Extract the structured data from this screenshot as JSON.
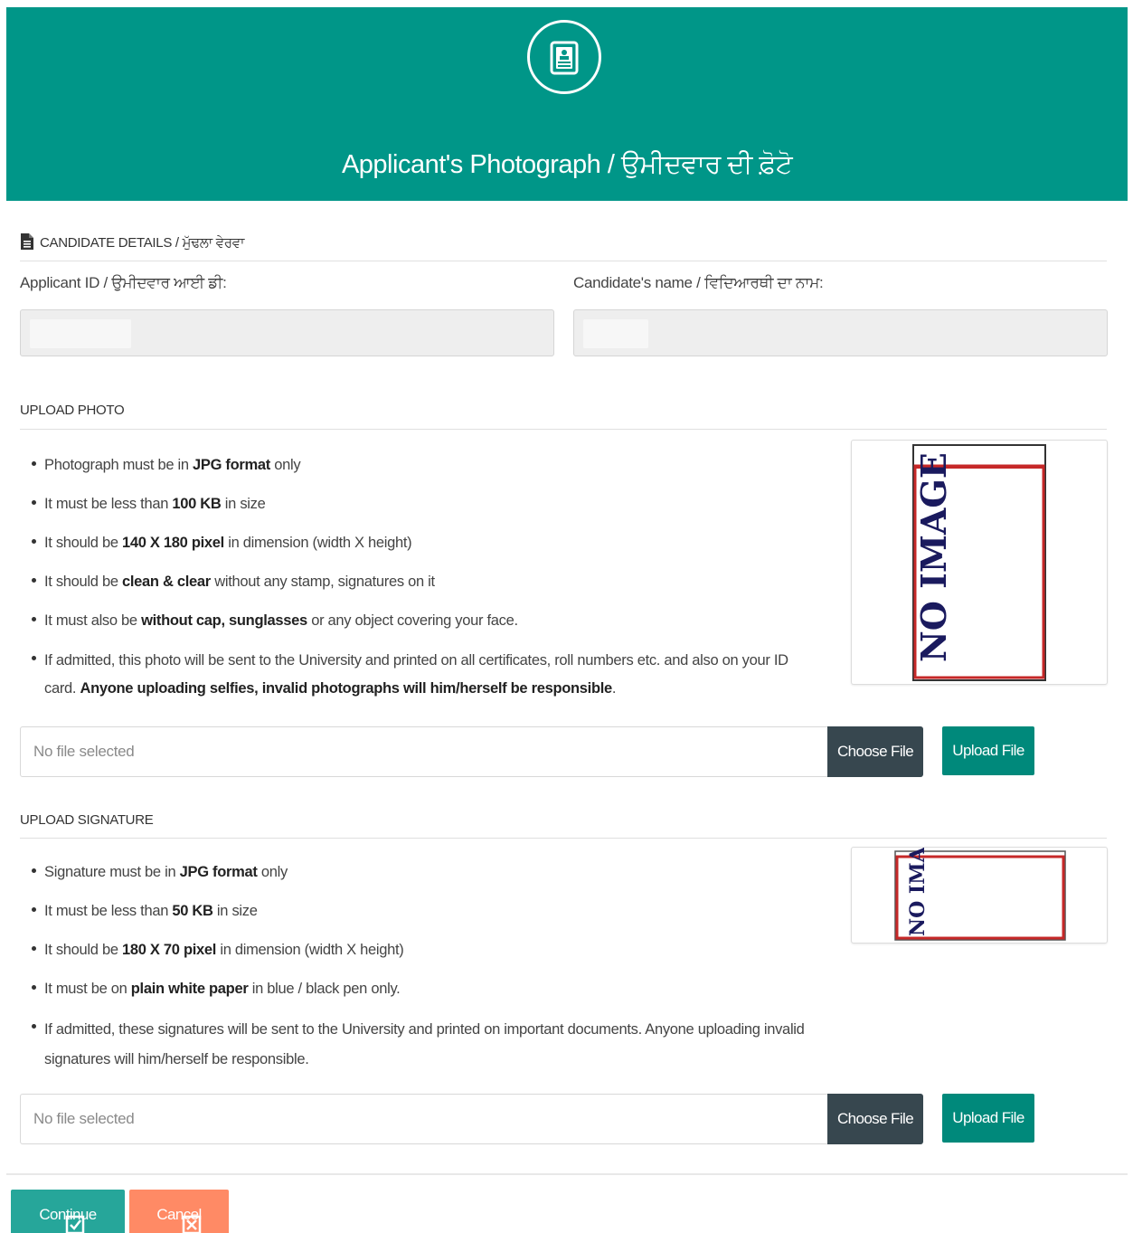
{
  "header": {
    "title": "Applicant's Photograph / ਉਮੀਦਵਾਰ ਦੀ ਫ਼ੋਟੋ",
    "icon": "id-card-icon"
  },
  "candidate": {
    "section_title": "CANDIDATE DETAILS / ਮੁੱਢਲਾ ਵੇਰਵਾ",
    "applicant_id_label": "Applicant ID / ਉਮੀਦਵਾਰ ਆਈ ਡੀ:",
    "name_label": "Candidate's name / ਵਿਦਿਆਰਥੀ ਦਾ ਨਾਮ:"
  },
  "photo": {
    "section_title": "UPLOAD PHOTO",
    "rules": [
      [
        "Photograph must be in ",
        "JPG format",
        " only"
      ],
      [
        "It must be less than ",
        "100 KB",
        " in size"
      ],
      [
        "It should be ",
        "140 X 180 pixel",
        " in dimension (width X height)"
      ],
      [
        "It should be ",
        "clean & clear",
        " without any stamp, signatures on it"
      ],
      [
        "It must also be ",
        "without cap, sunglasses",
        " or any object covering your face."
      ]
    ],
    "last_rule_text": "If admitted, this photo will be sent to the University and printed on all certificates, roll numbers etc. and also on your ID card. ",
    "last_rule_bold": "Anyone uploading selfies, invalid photographs will him/herself be responsible",
    "last_rule_end": ".",
    "preview_text": "NO IMAGE",
    "file_placeholder": "No file selected",
    "choose_label": "Choose File",
    "upload_label": "Upload File"
  },
  "signature": {
    "section_title": "UPLOAD SIGNATURE",
    "rules": [
      [
        "Signature must be in ",
        "JPG format",
        " only"
      ],
      [
        "It must be less than ",
        "50 KB",
        " in size"
      ],
      [
        "It should be ",
        "180 X 70 pixel",
        " in dimension (width X height)"
      ],
      [
        "It must be on ",
        "plain white paper",
        " in blue / black pen only."
      ]
    ],
    "last_rule_text": "If admitted, these signatures will be sent to the University and printed on important documents. Anyone uploading invalid signatures will him/herself be responsible.",
    "preview_text": "NO IMAGE",
    "file_placeholder": "No file selected",
    "choose_label": "Choose File",
    "upload_label": "Upload File"
  },
  "actions": {
    "continue_label": "Continue",
    "cancel_label": "Cancel"
  },
  "colors": {
    "header": "#009688",
    "upload_button": "#00897b",
    "choose_button": "#37474f",
    "continue_button": "#26a69a",
    "cancel_button": "#ff8a65",
    "preview_border": "#c62828"
  }
}
